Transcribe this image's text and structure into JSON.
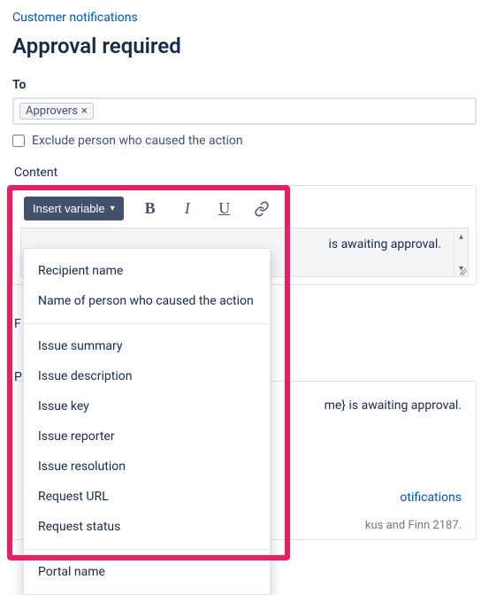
{
  "breadcrumb": "Customer notifications",
  "title": "Approval required",
  "to": {
    "label": "To",
    "chip": "Approvers",
    "exclude_label": "Exclude person who caused the action"
  },
  "content": {
    "label": "Content",
    "insert_variable_label": "Insert variable",
    "body_tail": " is awaiting approval."
  },
  "dropdown_items_a": [
    "Recipient name",
    "Name of person who caused the action"
  ],
  "dropdown_items_b": [
    "Issue summary",
    "Issue description",
    "Issue key",
    "Issue reporter",
    "Issue resolution",
    "Request URL",
    "Request status"
  ],
  "dropdown_items_c": [
    "Portal name"
  ],
  "edge_letter_1": "F",
  "edge_letter_2": "P",
  "preview": {
    "body_tail": "me} is awaiting approval.",
    "link_tail": "otifications",
    "footer_tail": "kus and Finn 2187."
  }
}
